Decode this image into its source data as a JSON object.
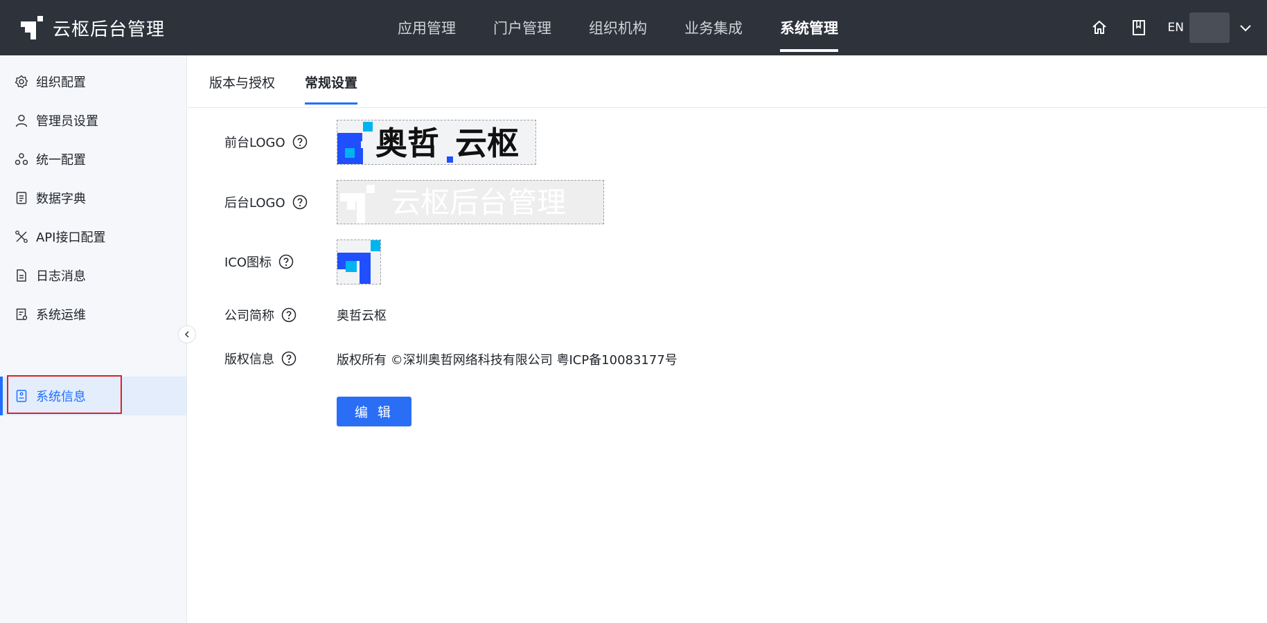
{
  "app": {
    "title": "云枢后台管理"
  },
  "topnav": {
    "items": [
      {
        "label": "应用管理"
      },
      {
        "label": "门户管理"
      },
      {
        "label": "组织机构"
      },
      {
        "label": "业务集成"
      },
      {
        "label": "系统管理"
      }
    ],
    "active_label": "系统管理"
  },
  "header": {
    "home_icon": "home-icon",
    "book_icon": "book-icon",
    "lang_label": "EN",
    "user_menu_icon": "chevron-down-icon"
  },
  "sidebar": {
    "items": [
      {
        "label": "组织配置",
        "icon": "gear-icon"
      },
      {
        "label": "管理员设置",
        "icon": "user-icon"
      },
      {
        "label": "统一配置",
        "icon": "network-icon"
      },
      {
        "label": "数据字典",
        "icon": "dictionary-icon"
      },
      {
        "label": "API接口配置",
        "icon": "api-icon"
      },
      {
        "label": "日志消息",
        "icon": "document-icon"
      },
      {
        "label": "系统运维",
        "icon": "maintenance-icon"
      },
      {
        "label": "系统信息",
        "icon": "info-doc-icon"
      }
    ],
    "active_label": "系统信息"
  },
  "tabs": {
    "items": [
      {
        "label": "版本与授权"
      },
      {
        "label": "常规设置"
      }
    ],
    "active_label": "常规设置"
  },
  "form": {
    "front_logo": {
      "label": "前台LOGO",
      "logo_text_1": "奥哲",
      "logo_text_2": "云枢"
    },
    "back_logo": {
      "label": "后台LOGO",
      "logo_text": "云枢后台管理"
    },
    "ico": {
      "label": "ICO图标"
    },
    "company_short": {
      "label": "公司简称",
      "value": "奥哲云枢"
    },
    "copyright": {
      "label": "版权信息",
      "value": "版权所有 ©深圳奥哲网络科技有限公司 粤ICP备10083177号"
    },
    "edit_button": "编 辑"
  },
  "colors": {
    "header_bg": "#2d323b",
    "accent": "#1f6fff",
    "sidebar_bg": "#f5f7fa",
    "sidebar_active_bg": "#e3edfc",
    "highlight_red": "#e02020",
    "logo_blue": "#1f4fff",
    "logo_cyan": "#00b4f0"
  }
}
